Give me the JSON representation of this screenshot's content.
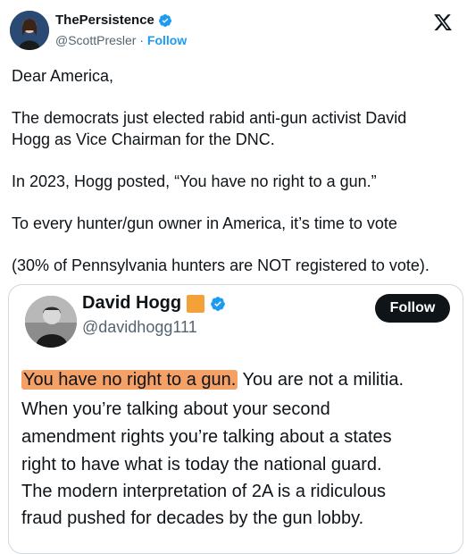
{
  "tweet": {
    "display_name": "ThePersistence",
    "handle": "@ScottPresler",
    "separator": "·",
    "follow_label": "Follow",
    "lines": [
      "Dear America,",
      "The democrats just elected rabid anti-gun activist David",
      "Hogg as Vice Chairman for the DNC.",
      "In 2023, Hogg posted, “You have no right to a gun.”",
      "To every hunter/gun owner in America, it’s time to vote",
      "(30% of Pennsylvania hunters are NOT registered to vote)."
    ]
  },
  "quoted": {
    "display_name": "David Hogg",
    "handle": "@davidhogg111",
    "follow_label": "Follow",
    "highlighted_text": "You have no right to a gun.",
    "first_line_rest": " You are not a militia.",
    "lines": [
      "When you’re talking about your second",
      "amendment rights you’re talking about a states",
      "right to have what is today the national guard.",
      "The modern interpretation of 2A is a ridiculous",
      "fraud pushed for decades by the gun lobby."
    ]
  },
  "colors": {
    "accent": "#1d9bf0",
    "highlight": "#f5a066",
    "follow_button": "#0f1419"
  },
  "icons": [
    "verified-badge-icon",
    "x-logo-icon",
    "orange-square-emoji"
  ]
}
